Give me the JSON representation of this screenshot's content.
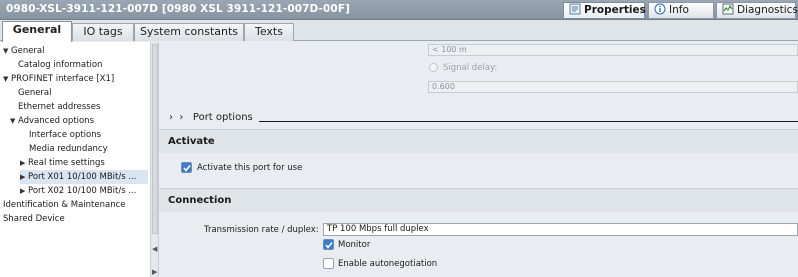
{
  "window": {
    "title": "0980-XSL-3911-121-007D [0980 XSL 3911-121-007D-00F]",
    "right_tabs": {
      "properties": "Properties",
      "info": "Info",
      "diagnostics": "Diagnostics"
    }
  },
  "tabs": [
    "General",
    "IO tags",
    "System constants",
    "Texts"
  ],
  "tree": {
    "items": [
      "General",
      "Catalog information",
      "PROFINET interface [X1]",
      "General",
      "Ethernet addresses",
      "Advanced options",
      "Interface options",
      "Media redundancy",
      "Real time settings",
      "Port X01 10/100 MBit/s ...",
      "Port X02 10/100 MBit/s ...",
      "Identification & Maintenance",
      "Shared Device"
    ]
  },
  "main": {
    "cable_length": "< 100 m",
    "signal_delay_label": "Signal delay:",
    "signal_delay_value": "0.600",
    "port_options_title": "Port options",
    "activate": {
      "title": "Activate",
      "checkbox_label": "Activate this port for use",
      "checked": true
    },
    "connection": {
      "title": "Connection",
      "rate_label": "Transmission rate / duplex:",
      "rate_value": "TP 100 Mbps full duplex",
      "monitor_label": "Monitor",
      "monitor_checked": true,
      "autoneg_label": "Enable autonegotiation",
      "autoneg_checked": false
    }
  },
  "colors": {
    "titlebar": "#8f9dab",
    "checkbox_checked": "#3d7cc9",
    "selection": "#d9e5f0"
  }
}
